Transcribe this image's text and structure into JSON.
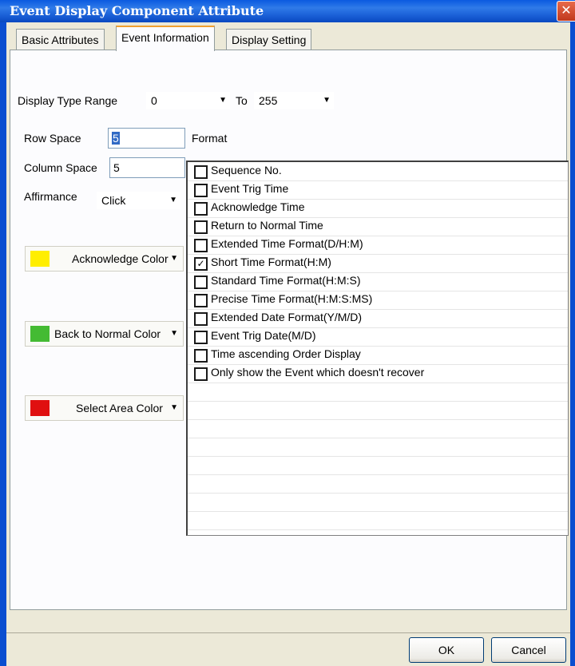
{
  "window": {
    "title": "Event Display Component Attribute",
    "close_glyph": "✕"
  },
  "tabs": [
    {
      "label": "Basic Attributes",
      "active": false
    },
    {
      "label": "Event Information",
      "active": true
    },
    {
      "label": "Display Setting",
      "active": false
    }
  ],
  "display_type_range": {
    "label": "Display Type Range",
    "from_value": "0",
    "to_label": "To",
    "to_value": "255"
  },
  "row_space": {
    "label": "Row Space",
    "value": "5"
  },
  "column_space": {
    "label": "Column Space",
    "value": "5"
  },
  "affirmance": {
    "label": "Affirmance",
    "value": "Click"
  },
  "format_label": "Format",
  "color_buttons": [
    {
      "label": "Acknowledge Color",
      "color": "#ffee00"
    },
    {
      "label": "Back to Normal Color",
      "color": "#44bb33"
    },
    {
      "label": "Select Area Color",
      "color": "#e01010"
    }
  ],
  "format_options": [
    {
      "label": "Sequence No.",
      "checked": false
    },
    {
      "label": "Event Trig Time",
      "checked": false
    },
    {
      "label": "Acknowledge Time",
      "checked": false
    },
    {
      "label": "Return to Normal Time",
      "checked": false
    },
    {
      "label": "Extended Time Format(D/H:M)",
      "checked": false
    },
    {
      "label": "Short Time Format(H:M)",
      "checked": true
    },
    {
      "label": "Standard Time Format(H:M:S)",
      "checked": false
    },
    {
      "label": "Precise Time Format(H:M:S:MS)",
      "checked": false
    },
    {
      "label": "Extended Date Format(Y/M/D)",
      "checked": false
    },
    {
      "label": "Event Trig Date(M/D)",
      "checked": false
    },
    {
      "label": "Time ascending Order Display",
      "checked": false
    },
    {
      "label": "Only show the Event which doesn't recover",
      "checked": false
    }
  ],
  "footer": {
    "ok_label": "OK",
    "cancel_label": "Cancel"
  },
  "icons": {
    "dropdown": "▼",
    "checkmark": "✓"
  }
}
